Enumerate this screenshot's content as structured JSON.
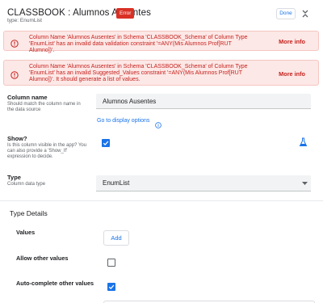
{
  "header": {
    "title": "CLASSBOOK : Alumnos Ausentes",
    "badge": "Error",
    "subtitle": "type: EnumList",
    "done_label": "Done",
    "collapse_icon": "unfold-less-icon"
  },
  "alerts": [
    {
      "icon": "error-icon",
      "text": "Column Name 'Alumnos Ausentes' in Schema 'CLASSBOOK_Schema' of Column Type 'EnumList' has an invalid data validation constraint '=ANY(Mis Alumnos Prof[RUT Alumno])'.",
      "action": "More info"
    },
    {
      "icon": "error-icon",
      "text": "Column Name 'Alumnos Ausentes' in Schema 'CLASSBOOK_Schema' of Column Type 'EnumList' has an invalid Suggested_Values constraint '=ANY(Mis Alumnos Prof[RUT Alumno])'. It should generate a list of values.",
      "action": "More info"
    }
  ],
  "column_name": {
    "label": "Column name",
    "hint": "Should match the column name in the data source",
    "value": "Alumnos Ausentes",
    "link": "Go to display options"
  },
  "show": {
    "label": "Show?",
    "hint": "Is this column visible in the app? You can also provide a 'Show_If' expression to decide.",
    "checked": true
  },
  "type": {
    "label": "Type",
    "hint": "Column data type",
    "value": "EnumList"
  },
  "type_details": {
    "title": "Type Details",
    "values_label": "Values",
    "add_label": "Add",
    "allow_other_label": "Allow other values",
    "allow_other_checked": false,
    "autocomplete_label": "Auto-complete other values",
    "autocomplete_checked": true
  },
  "colors": {
    "error": "#d93025",
    "accent": "#1a73e8",
    "alert_bg": "#fce8e6"
  }
}
